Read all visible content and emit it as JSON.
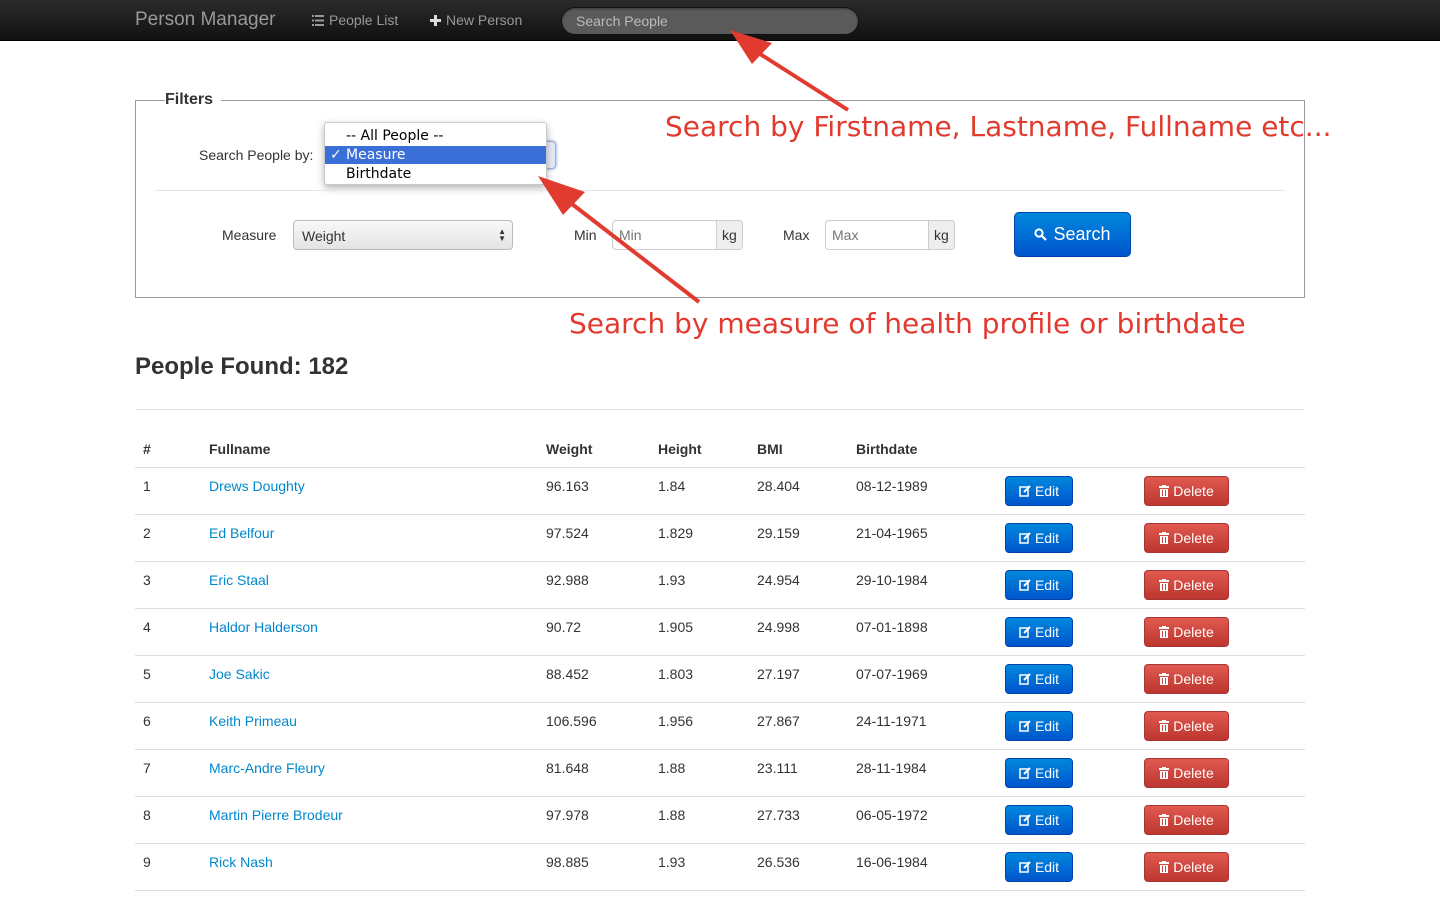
{
  "navbar": {
    "brand": "Person Manager",
    "people_list": "People List",
    "new_person": "New Person",
    "search_placeholder": "Search People"
  },
  "filters": {
    "legend": "Filters",
    "search_by_label": "Search People by:",
    "search_by_options": [
      "-- All People --",
      "Measure",
      "Birthdate"
    ],
    "search_by_selected": "Measure",
    "measure_label": "Measure",
    "measure_selected": "Weight",
    "min_label": "Min",
    "min_placeholder": "Min",
    "min_unit": "kg",
    "max_label": "Max",
    "max_placeholder": "Max",
    "max_unit": "kg",
    "search_button": "Search"
  },
  "annotations": {
    "top": "Search by Firstname, Lastname, Fullname etc...",
    "bottom": "Search by measure of health profile or birthdate"
  },
  "results": {
    "title": "People Found: 182",
    "columns": [
      "#",
      "Fullname",
      "Weight",
      "Height",
      "BMI",
      "Birthdate"
    ],
    "edit_label": "Edit",
    "delete_label": "Delete",
    "rows": [
      {
        "n": "1",
        "name": "Drews Doughty",
        "weight": "96.163",
        "height": "1.84",
        "bmi": "28.404",
        "birthdate": "08-12-1989"
      },
      {
        "n": "2",
        "name": "Ed Belfour",
        "weight": "97.524",
        "height": "1.829",
        "bmi": "29.159",
        "birthdate": "21-04-1965"
      },
      {
        "n": "3",
        "name": "Eric Staal",
        "weight": "92.988",
        "height": "1.93",
        "bmi": "24.954",
        "birthdate": "29-10-1984"
      },
      {
        "n": "4",
        "name": "Haldor Halderson",
        "weight": "90.72",
        "height": "1.905",
        "bmi": "24.998",
        "birthdate": "07-01-1898"
      },
      {
        "n": "5",
        "name": "Joe Sakic",
        "weight": "88.452",
        "height": "1.803",
        "bmi": "27.197",
        "birthdate": "07-07-1969"
      },
      {
        "n": "6",
        "name": "Keith Primeau",
        "weight": "106.596",
        "height": "1.956",
        "bmi": "27.867",
        "birthdate": "24-11-1971"
      },
      {
        "n": "7",
        "name": "Marc-Andre Fleury",
        "weight": "81.648",
        "height": "1.88",
        "bmi": "23.111",
        "birthdate": "28-11-1984"
      },
      {
        "n": "8",
        "name": "Martin Pierre Brodeur",
        "weight": "97.978",
        "height": "1.88",
        "bmi": "27.733",
        "birthdate": "06-05-1972"
      },
      {
        "n": "9",
        "name": "Rick Nash",
        "weight": "98.885",
        "height": "1.93",
        "bmi": "26.536",
        "birthdate": "16-06-1984"
      }
    ]
  },
  "colors": {
    "annotation": "#e13b2f",
    "link": "#0088cc",
    "primary_button": "#0066cc",
    "danger_button": "#bd362f"
  }
}
